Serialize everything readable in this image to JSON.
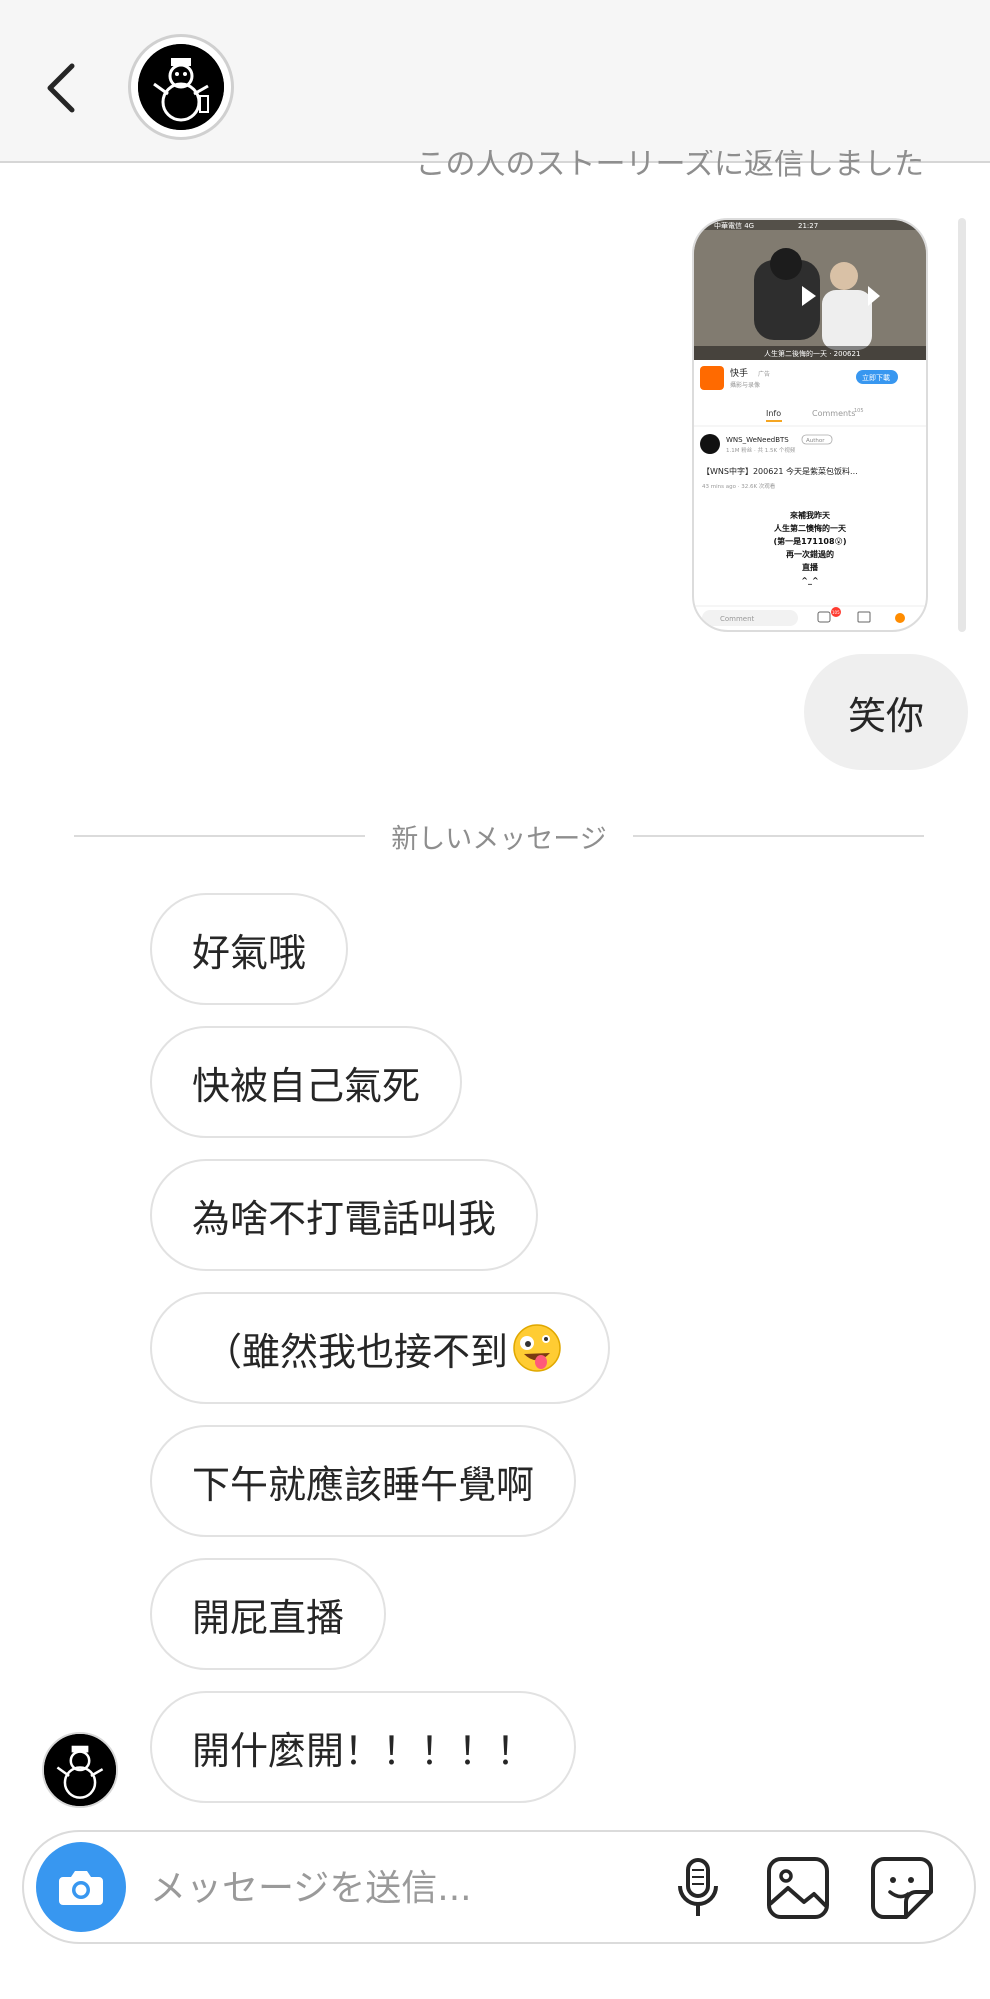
{
  "header": {
    "back_icon": "chevron-left-icon",
    "avatar_icon": "snowman-avatar"
  },
  "thread": {
    "story_reply_note": "この人のストーリーズに返信しました",
    "story_card": {
      "status_left": "中華電信 4G",
      "status_time": "21:27",
      "video_caption": "人生第二後悔的一天 · 200621",
      "app_name": "快手",
      "app_tag": "广告",
      "app_sub": "攝影与录像",
      "download_label": "立即下載",
      "tab_info": "Info",
      "tab_comments": "Comments",
      "tab_comments_count": "105",
      "author_name": "WNS_WeNeedBTS",
      "author_badge": "Author",
      "author_meta": "1.1M 粉丝 · 共 1.5K 个视频",
      "post_title": "【WNS中字】200621 今天是紫菜包饭料...",
      "post_meta": "43 mins ago · 32.6K 次观看",
      "body_lines": [
        "來補我昨天",
        "人生第二懊悔的一天",
        "(第一是171108😮)",
        "再一次錯過的",
        "直播",
        "^_^"
      ],
      "comment_placeholder": "Comment",
      "comment_badge": "105"
    },
    "sent_messages": [
      "笑你"
    ],
    "divider_label": "新しいメッセージ",
    "received_messages": [
      "好氣哦",
      "快被自己氣死",
      "為啥不打電話叫我",
      "（雖然我也接不到",
      "下午就應該睡午覺啊",
      "開屁直播",
      "開什麼開！！！！！"
    ],
    "emoji_icon": "zany-face-emoji"
  },
  "composer": {
    "placeholder": "メッセージを送信...",
    "camera_icon": "camera-icon",
    "mic_icon": "microphone-icon",
    "gallery_icon": "gallery-icon",
    "sticker_icon": "sticker-icon",
    "accent_color": "#3897f0"
  }
}
